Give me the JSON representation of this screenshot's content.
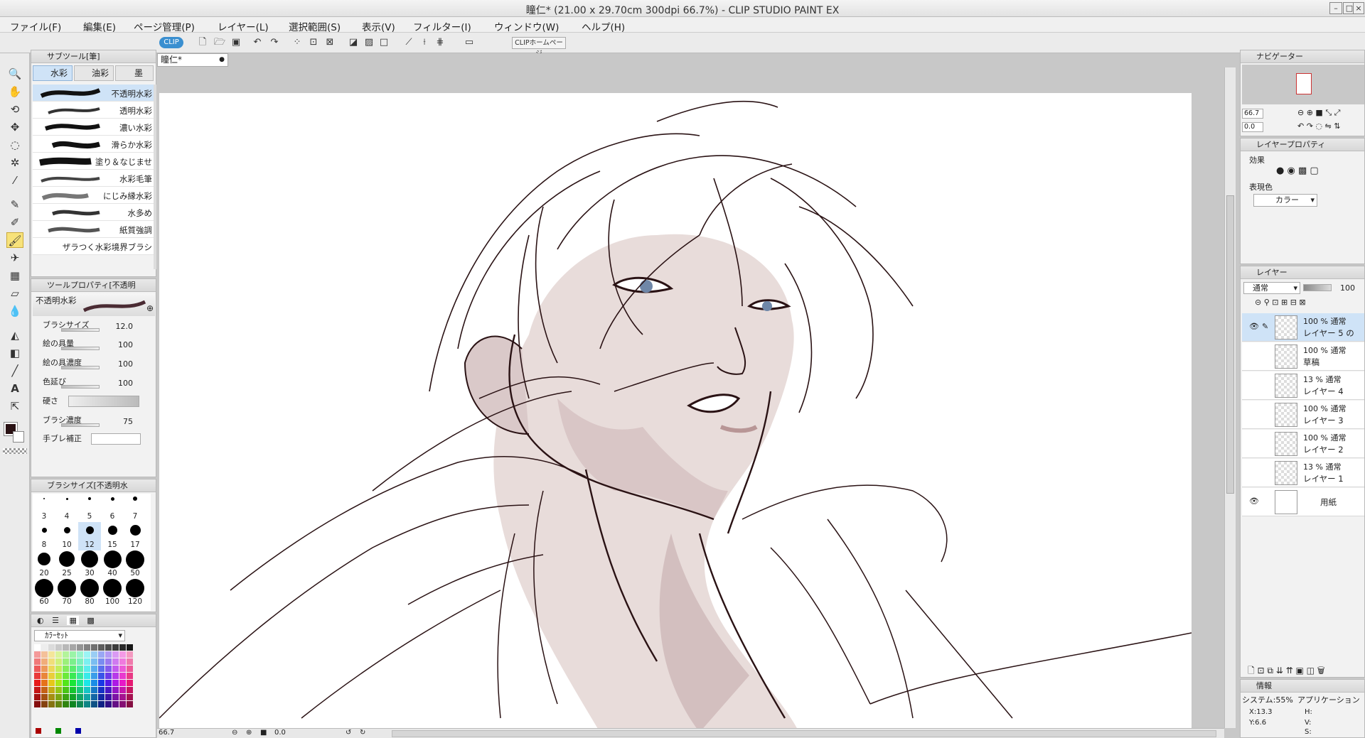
{
  "window": {
    "title": "瞳仁* (21.00 x 29.70cm 300dpi 66.7%)  - CLIP STUDIO PAINT EX"
  },
  "menu": [
    "ファイル(F)",
    "編集(E)",
    "ページ管理(P)",
    "レイヤー(L)",
    "選択範囲(S)",
    "表示(V)",
    "フィルター(I)",
    "ウィンドウ(W)",
    "ヘルプ(H)"
  ],
  "toolbar": {
    "clip_badge": "CLIP",
    "clip_home": "CLIPホームページ"
  },
  "document": {
    "tab": "瞳仁*"
  },
  "subtool": {
    "header": "サブツール[筆]",
    "tabs": [
      "水彩",
      "油彩",
      "墨"
    ],
    "brushes": [
      "不透明水彩",
      "透明水彩",
      "濃い水彩",
      "滑らか水彩",
      "塗り＆なじませ",
      "水彩毛筆",
      "にじみ縁水彩",
      "水多め",
      "紙質強調",
      "ザラつく水彩境界ブラシ"
    ]
  },
  "toolprop": {
    "header": "ツールプロパティ[不透明",
    "name": "不透明水彩",
    "props": [
      {
        "label": "ブラシサイズ",
        "value": "12.0"
      },
      {
        "label": "絵の具量",
        "value": "100"
      },
      {
        "label": "絵の具濃度",
        "value": "100"
      },
      {
        "label": "色延び",
        "value": "100"
      },
      {
        "label": "硬さ",
        "value": ""
      },
      {
        "label": "ブラシ濃度",
        "value": "75"
      },
      {
        "label": "手ブレ補正",
        "value": ""
      }
    ]
  },
  "brushsize": {
    "header": "ブラシサイズ[不透明水",
    "sizes": [
      "3",
      "4",
      "5",
      "6",
      "7",
      "8",
      "10",
      "12",
      "15",
      "17",
      "20",
      "25",
      "30",
      "40",
      "50",
      "60",
      "70",
      "80",
      "100",
      "120"
    ]
  },
  "colorset": {
    "name": "ｶﾗｰｾｯﾄ"
  },
  "navigator": {
    "header": "ナビゲーター",
    "zoom": "66.7",
    "angle": "0.0"
  },
  "layerprop": {
    "header": "レイヤープロパティ",
    "effect_label": "効果",
    "color_label": "表現色",
    "color_value": "カラー"
  },
  "layers": {
    "header": "レイヤー",
    "blend": "通常",
    "opacity": "100",
    "rows": [
      {
        "top": "100 %  通常",
        "name": "レイヤー 5 の"
      },
      {
        "top": "100 %  通常",
        "name": "草稿"
      },
      {
        "top": "13 %  通常",
        "name": "レイヤー 4"
      },
      {
        "top": "100 %  通常",
        "name": "レイヤー 3"
      },
      {
        "top": "100 %  通常",
        "name": "レイヤー 2"
      },
      {
        "top": "13 %  通常",
        "name": "レイヤー 1"
      },
      {
        "top": "",
        "name": "用紙"
      }
    ]
  },
  "info": {
    "header": "情報",
    "system": "システム:55%",
    "app": "アプリケーション",
    "x": "X:13.3",
    "y": "Y:6.6",
    "h": "H:",
    "v": "V:",
    "s": "S:"
  },
  "status": {
    "zoom": "66.7",
    "angle": "0.0"
  },
  "colors": {
    "accent": "#cfe3f7",
    "line": "#2a1214",
    "skin": "#e3d5d3"
  }
}
